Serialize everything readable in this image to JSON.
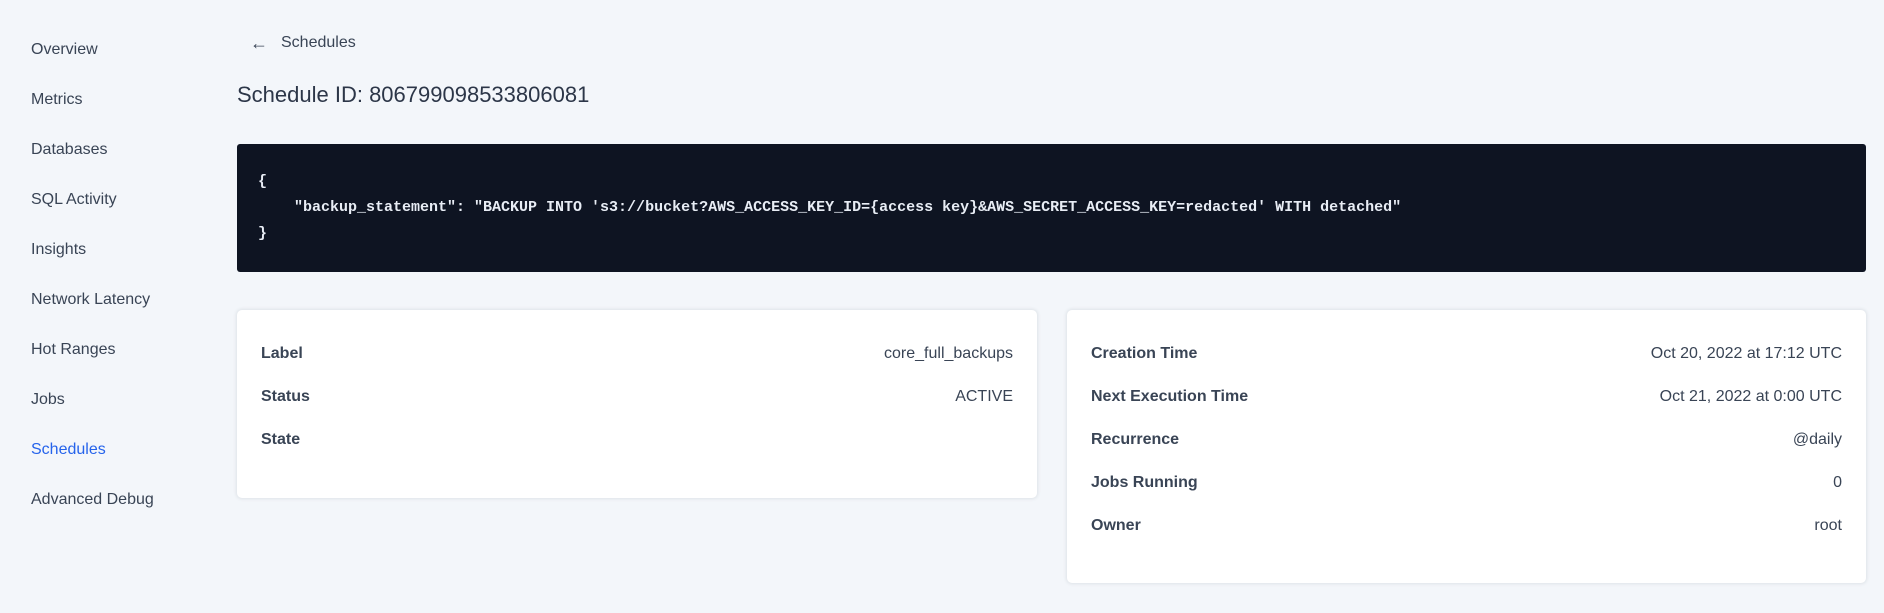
{
  "sidebar": {
    "items": [
      {
        "label": "Overview",
        "active": false
      },
      {
        "label": "Metrics",
        "active": false
      },
      {
        "label": "Databases",
        "active": false
      },
      {
        "label": "SQL Activity",
        "active": false
      },
      {
        "label": "Insights",
        "active": false
      },
      {
        "label": "Network Latency",
        "active": false
      },
      {
        "label": "Hot Ranges",
        "active": false
      },
      {
        "label": "Jobs",
        "active": false
      },
      {
        "label": "Schedules",
        "active": true
      },
      {
        "label": "Advanced Debug",
        "active": false
      }
    ]
  },
  "header": {
    "back_icon": "←",
    "back_label": "Schedules",
    "page_title": "Schedule ID: 806799098533806081"
  },
  "code_block": {
    "text": "{\n    \"backup_statement\": \"BACKUP INTO 's3://bucket?AWS_ACCESS_KEY_ID={access key}&AWS_SECRET_ACCESS_KEY=redacted' WITH detached\"\n}"
  },
  "details_card": {
    "rows": [
      {
        "label": "Label",
        "value": "core_full_backups"
      },
      {
        "label": "Status",
        "value": "ACTIVE"
      },
      {
        "label": "State",
        "value": ""
      }
    ]
  },
  "schedule_card": {
    "rows": [
      {
        "label": "Creation Time",
        "value": "Oct 20, 2022 at 17:12 UTC"
      },
      {
        "label": "Next Execution Time",
        "value": "Oct 21, 2022 at 0:00 UTC"
      },
      {
        "label": "Recurrence",
        "value": "@daily"
      },
      {
        "label": "Jobs Running",
        "value": "0"
      },
      {
        "label": "Owner",
        "value": "root"
      }
    ]
  },
  "colors": {
    "active_link": "#2563eb",
    "code_background": "#0e1422",
    "page_background": "#f3f6fa"
  }
}
